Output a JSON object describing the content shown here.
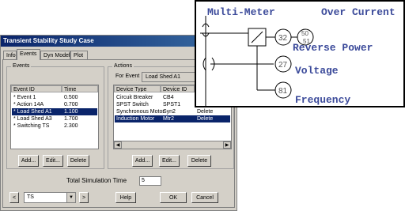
{
  "dialog": {
    "title": "Transient Stability Study Case",
    "tabs": [
      "Info",
      "Events",
      "Dyn Model",
      "Plot"
    ],
    "events_group": "Events",
    "events_headers": [
      "Event ID",
      "Time"
    ],
    "events": [
      {
        "id": "* Event 1",
        "time": "0.500"
      },
      {
        "id": "* Action 14A",
        "time": "0.700"
      },
      {
        "id": "* Load Shed A1",
        "time": "1.100"
      },
      {
        "id": "* Load Shed A3",
        "time": "1.700"
      },
      {
        "id": "* Switching TS",
        "time": "2.300"
      }
    ],
    "selected_event_index": 2,
    "actions_group": "Actions",
    "for_event_label": "For Event",
    "for_event_value": "Load Shed A1",
    "actions_headers": [
      "Device Type",
      "Device ID",
      "A"
    ],
    "actions": [
      {
        "type": "Circuit Breaker",
        "id": "CB4",
        "action": "C"
      },
      {
        "type": "SPST Switch",
        "id": "SPST1",
        "action": "C"
      },
      {
        "type": "Synchronous Motor",
        "id": "Syn2",
        "action": "Delete"
      },
      {
        "type": "Induction Motor",
        "id": "Mtr2",
        "action": "Delete"
      }
    ],
    "selected_action_index": 3,
    "buttons": {
      "add": "Add...",
      "edit": "Edit...",
      "delete": "Delete",
      "help": "Help",
      "ok": "OK",
      "cancel": "Cancel"
    },
    "total_sim_label": "Total Simulation Time",
    "total_sim_value": "5",
    "study_case": "TS",
    "nav_prev": "<",
    "nav_next": ">"
  },
  "diagram": {
    "multimeter": "Multi-Meter",
    "overcurrent": "Over Current",
    "reverse_power": "Reverse Power",
    "voltage": "Voltage",
    "frequency": "Frequency",
    "relay_32": "32",
    "relay_50": "50",
    "relay_51": "51",
    "relay_27": "27",
    "relay_81": "81",
    "text_color": "#3b4a9a"
  }
}
